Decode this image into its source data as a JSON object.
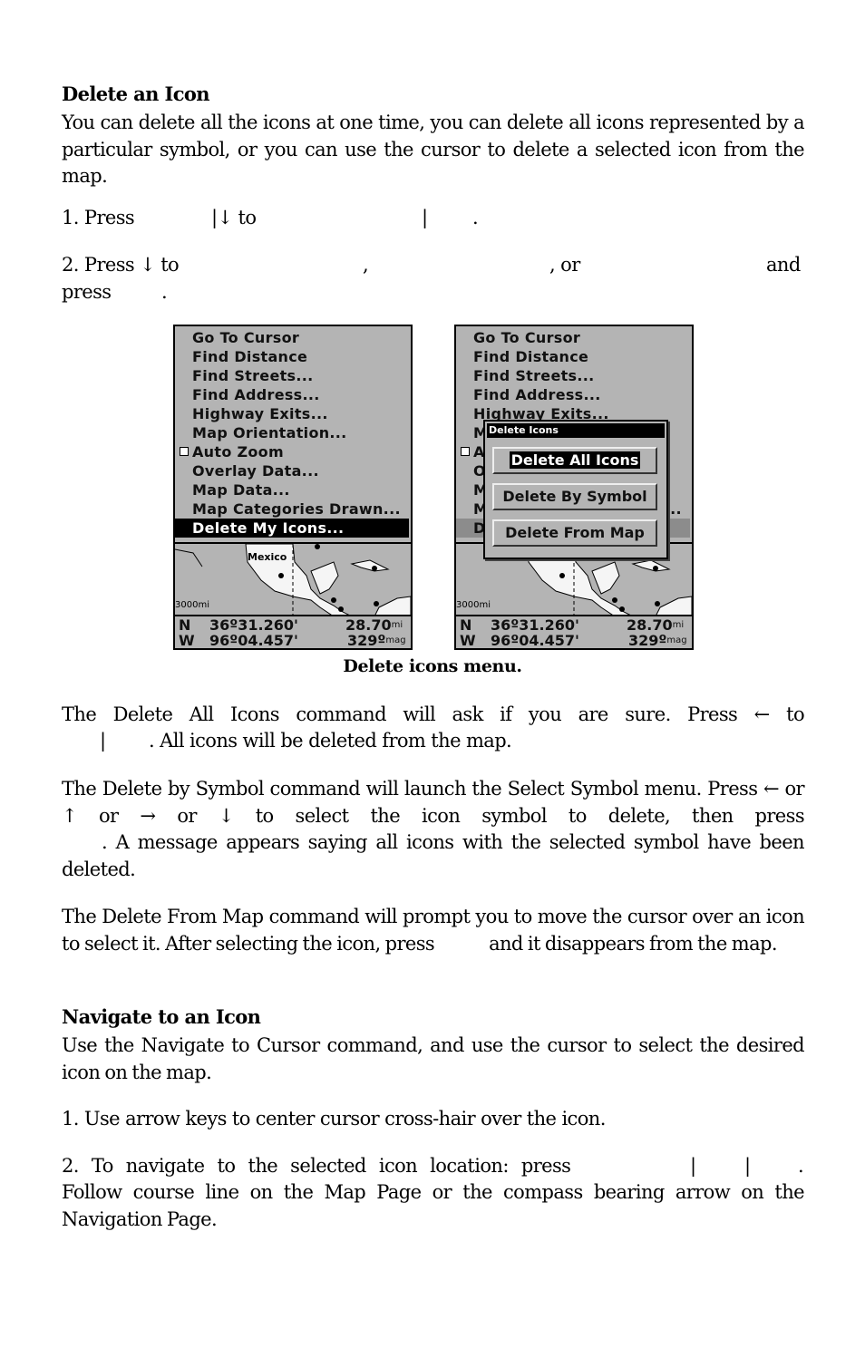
{
  "section1": {
    "heading": "Delete an Icon",
    "intro": "You can delete all the icons at one time, you can delete all icons represented by a particular symbol, or you can use the cursor to delete a selected icon from the map.",
    "step1": {
      "prefix": "1. Press",
      "sep1": "|↓ to",
      "sep2": "|",
      "end": "."
    },
    "step2": {
      "prefix": "2. Press ↓ to",
      "comma": ",",
      "or": ", or",
      "and": "and",
      "press": "press",
      "end": "."
    }
  },
  "figure": {
    "caption": "Delete icons menu.",
    "menu_items": [
      "Go To Cursor",
      "Find Distance",
      "Find Streets...",
      "Find Address...",
      "Highway Exits...",
      "Map Orientation...",
      "Auto Zoom",
      "Overlay Data...",
      "Map Data...",
      "Map Categories Drawn...",
      "Delete My Icons..."
    ],
    "selected_index": 10,
    "auto_zoom_checked": false,
    "map": {
      "label": "Mexico",
      "scale": "3000mi"
    },
    "readout": {
      "lat_dir": "N",
      "lat": "36º31.260'",
      "lon_dir": "W",
      "lon": "96º04.457'",
      "distance": "28.70",
      "distance_unit": "mi",
      "bearing": "329º",
      "bearing_unit": "mag"
    },
    "dialog": {
      "title": "Delete Icons",
      "buttons": [
        "Delete All Icons",
        "Delete By Symbol",
        "Delete From Map"
      ],
      "selected_index": 0
    }
  },
  "section2": {
    "p1_line1": "The Delete All Icons command will ask if you are sure. Press ← to",
    "p1_line2_sep": "|",
    "p1_line2": ". All icons will be deleted from the map.",
    "p2": "The Delete by Symbol command will launch the Select Symbol menu. Press ← or ↑ or → or ↓ to select the icon symbol to delete, then press",
    "p2_cont": ". A message appears saying all icons with the selected symbol have been deleted.",
    "p3_a": "The Delete From Map command will prompt you to move the cursor over an icon to select it. After selecting the icon, press",
    "p3_b": "and it disappears from the map."
  },
  "section3": {
    "heading": "Navigate to an Icon",
    "intro": "Use the Navigate to Cursor command, and use the cursor to select the desired icon on the map.",
    "step1": "1. Use arrow keys to center cursor cross-hair over the icon.",
    "step2_prefix": "2. To navigate to the selected icon location: press",
    "step2_sep": "|",
    "step2_end": ".",
    "step2_cont": "Follow course line on the Map Page or the compass bearing arrow on the Navigation Page."
  }
}
